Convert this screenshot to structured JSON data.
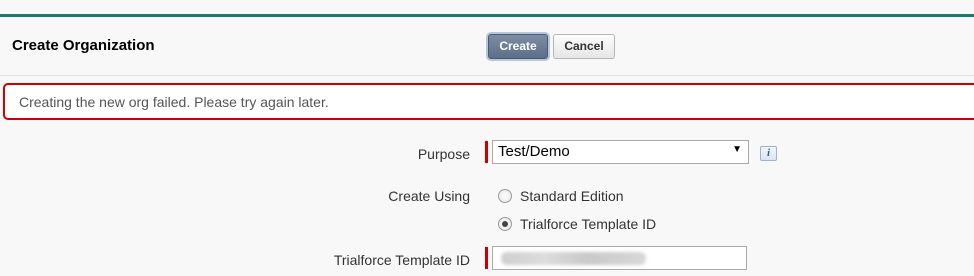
{
  "header": {
    "title": "Create Organization",
    "create_label": "Create",
    "cancel_label": "Cancel"
  },
  "error": {
    "message": "Creating the new org failed. Please try again later."
  },
  "form": {
    "purpose": {
      "label": "Purpose",
      "selected": "Test/Demo",
      "required": true,
      "info_icon": "info-icon"
    },
    "create_using": {
      "label": "Create Using",
      "options": [
        {
          "label": "Standard Edition",
          "checked": false
        },
        {
          "label": "Trialforce Template ID",
          "checked": true
        }
      ]
    },
    "template_id": {
      "label": "Trialforce Template ID",
      "required": true,
      "value_obscured": true
    }
  },
  "colors": {
    "accent_rule": "#1b7d6b",
    "error_border": "#cc0000",
    "required_bar": "#cc0000",
    "primary_button": "#5c6f8a"
  }
}
